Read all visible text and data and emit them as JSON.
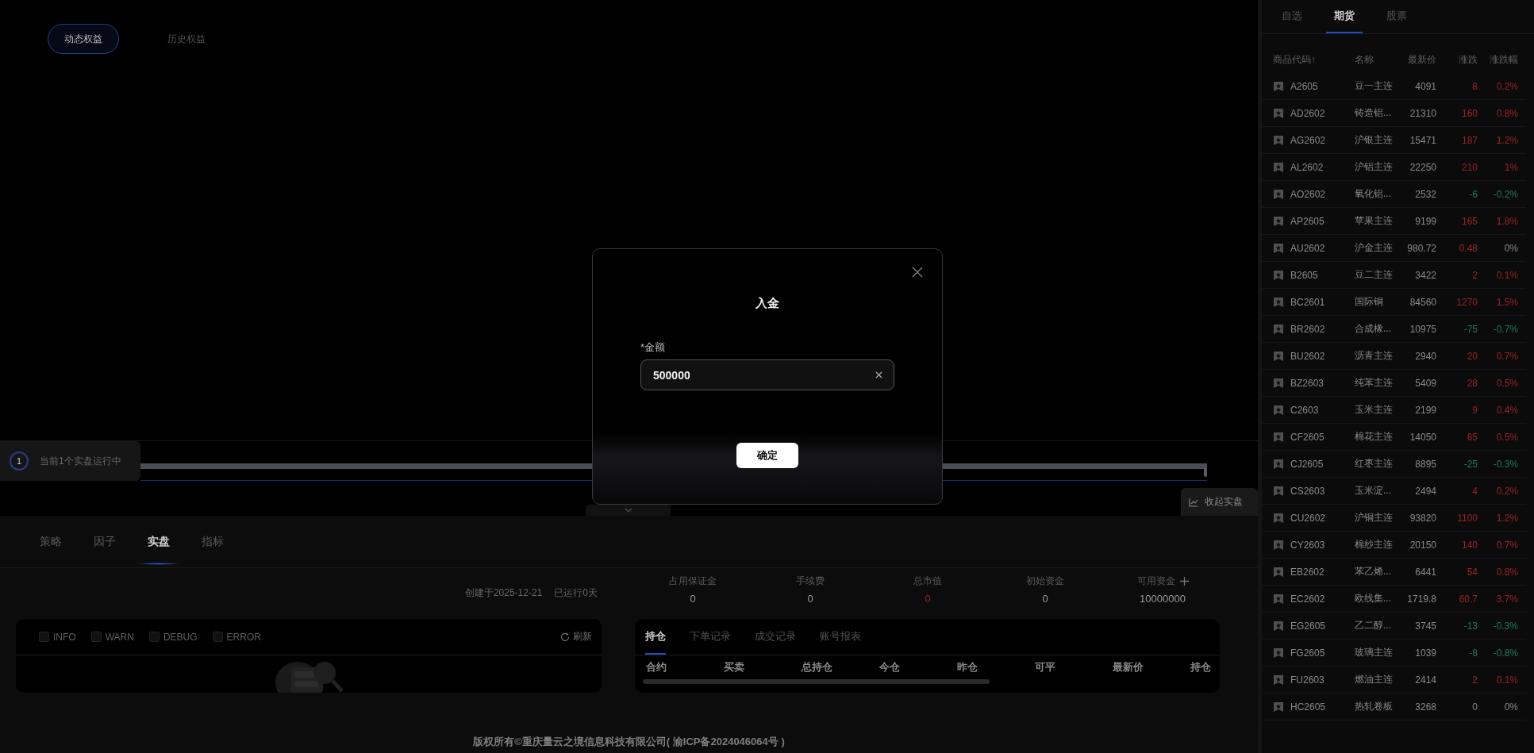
{
  "equity_tabs": [
    {
      "label": "动态权益",
      "selected": true
    },
    {
      "label": "历史权益",
      "selected": false
    }
  ],
  "running_badge": {
    "count": "1",
    "label": "当前1个实盘运行中"
  },
  "range_slider": {
    "level": 1
  },
  "collapse_button": "收起实盘",
  "bottom_tabs": [
    {
      "label": "策略",
      "selected": false
    },
    {
      "label": "因子",
      "selected": false
    },
    {
      "label": "实盘",
      "selected": true
    },
    {
      "label": "指标",
      "selected": false
    }
  ],
  "info": {
    "created": "创建于2025-12-21",
    "running": "已运行0天"
  },
  "stats": [
    {
      "label": "占用保证金",
      "value": "0",
      "color": "#9a9a9a",
      "add_button": false
    },
    {
      "label": "手续费",
      "value": "0",
      "color": "#9a9a9a",
      "add_button": false
    },
    {
      "label": "总市值",
      "value": "0",
      "color": "#9c2228",
      "add_button": false
    },
    {
      "label": "初始资金",
      "value": "0",
      "color": "#9a9a9a",
      "add_button": false
    },
    {
      "label": "可用资金",
      "value": "10000000",
      "color": "#9a9a9a",
      "add_button": true
    }
  ],
  "log_panel": {
    "levels": [
      {
        "label": "INFO",
        "checked": false
      },
      {
        "label": "WARN",
        "checked": false
      },
      {
        "label": "DEBUG",
        "checked": false
      },
      {
        "label": "ERROR",
        "checked": false
      }
    ],
    "refresh": "刷新"
  },
  "positions_panel": {
    "tabs": [
      {
        "label": "持仓",
        "selected": true
      },
      {
        "label": "下单记录",
        "selected": false
      },
      {
        "label": "成交记录",
        "selected": false
      },
      {
        "label": "账号报表",
        "selected": false
      }
    ],
    "columns": [
      "合约",
      "买卖",
      "总持仓",
      "今仓",
      "昨仓",
      "可平",
      "最新价",
      "持仓"
    ]
  },
  "footer": "版权所有©重庆量云之境信息科技有限公司( 渝ICP备2024046064号 )",
  "market": {
    "tabs": [
      {
        "label": "自选",
        "selected": false
      },
      {
        "label": "期货",
        "selected": true
      },
      {
        "label": "股票",
        "selected": false
      }
    ],
    "columns": [
      "商品代码↑",
      "名称",
      "最新价",
      "涨跌",
      "涨跌幅"
    ],
    "rows": [
      {
        "code": "A2605",
        "name": "豆一主连",
        "price": "4091",
        "change": {
          "text": "8",
          "color": "#9c2228"
        },
        "pct": {
          "text": "0.2%",
          "color": "#9c2228"
        }
      },
      {
        "code": "AD2602",
        "name": "铸造铝...",
        "price": "21310",
        "change": {
          "text": "160",
          "color": "#9c2228"
        },
        "pct": {
          "text": "0.8%",
          "color": "#9c2228"
        }
      },
      {
        "code": "AG2602",
        "name": "沪银主连",
        "price": "15471",
        "change": {
          "text": "187",
          "color": "#9c2228"
        },
        "pct": {
          "text": "1.2%",
          "color": "#9c2228"
        }
      },
      {
        "code": "AL2602",
        "name": "沪铝主连",
        "price": "22250",
        "change": {
          "text": "210",
          "color": "#9c2228"
        },
        "pct": {
          "text": "1%",
          "color": "#9c2228"
        }
      },
      {
        "code": "AO2602",
        "name": "氧化铝...",
        "price": "2532",
        "change": {
          "text": "-6",
          "color": "#1e7a58"
        },
        "pct": {
          "text": "-0.2%",
          "color": "#1e7a58"
        }
      },
      {
        "code": "AP2605",
        "name": "苹果主连",
        "price": "9199",
        "change": {
          "text": "165",
          "color": "#9c2228"
        },
        "pct": {
          "text": "1.8%",
          "color": "#9c2228"
        }
      },
      {
        "code": "AU2602",
        "name": "沪金主连",
        "price": "980.72",
        "change": {
          "text": "0.48",
          "color": "#9c2228"
        },
        "pct": {
          "text": "0%",
          "color": "#8a8a8a"
        }
      },
      {
        "code": "B2605",
        "name": "豆二主连",
        "price": "3422",
        "change": {
          "text": "2",
          "color": "#9c2228"
        },
        "pct": {
          "text": "0.1%",
          "color": "#9c2228"
        }
      },
      {
        "code": "BC2601",
        "name": "国际铜",
        "price": "84560",
        "change": {
          "text": "1270",
          "color": "#9c2228"
        },
        "pct": {
          "text": "1.5%",
          "color": "#9c2228"
        }
      },
      {
        "code": "BR2602",
        "name": "合成橡...",
        "price": "10975",
        "change": {
          "text": "-75",
          "color": "#1e7a58"
        },
        "pct": {
          "text": "-0.7%",
          "color": "#1e7a58"
        }
      },
      {
        "code": "BU2602",
        "name": "沥青主连",
        "price": "2940",
        "change": {
          "text": "20",
          "color": "#9c2228"
        },
        "pct": {
          "text": "0.7%",
          "color": "#9c2228"
        }
      },
      {
        "code": "BZ2603",
        "name": "纯苯主连",
        "price": "5409",
        "change": {
          "text": "28",
          "color": "#9c2228"
        },
        "pct": {
          "text": "0.5%",
          "color": "#9c2228"
        }
      },
      {
        "code": "C2603",
        "name": "玉米主连",
        "price": "2199",
        "change": {
          "text": "9",
          "color": "#9c2228"
        },
        "pct": {
          "text": "0.4%",
          "color": "#9c2228"
        }
      },
      {
        "code": "CF2605",
        "name": "棉花主连",
        "price": "14050",
        "change": {
          "text": "65",
          "color": "#9c2228"
        },
        "pct": {
          "text": "0.5%",
          "color": "#9c2228"
        }
      },
      {
        "code": "CJ2605",
        "name": "红枣主连",
        "price": "8895",
        "change": {
          "text": "-25",
          "color": "#1e7a58"
        },
        "pct": {
          "text": "-0.3%",
          "color": "#1e7a58"
        }
      },
      {
        "code": "CS2603",
        "name": "玉米淀...",
        "price": "2494",
        "change": {
          "text": "4",
          "color": "#9c2228"
        },
        "pct": {
          "text": "0.2%",
          "color": "#9c2228"
        }
      },
      {
        "code": "CU2602",
        "name": "沪铜主连",
        "price": "93820",
        "change": {
          "text": "1100",
          "color": "#9c2228"
        },
        "pct": {
          "text": "1.2%",
          "color": "#9c2228"
        }
      },
      {
        "code": "CY2603",
        "name": "棉纱主连",
        "price": "20150",
        "change": {
          "text": "140",
          "color": "#9c2228"
        },
        "pct": {
          "text": "0.7%",
          "color": "#9c2228"
        }
      },
      {
        "code": "EB2602",
        "name": "苯乙烯...",
        "price": "6441",
        "change": {
          "text": "54",
          "color": "#9c2228"
        },
        "pct": {
          "text": "0.8%",
          "color": "#9c2228"
        }
      },
      {
        "code": "EC2602",
        "name": "欧线集...",
        "price": "1719.8",
        "change": {
          "text": "60.7",
          "color": "#9c2228"
        },
        "pct": {
          "text": "3.7%",
          "color": "#9c2228"
        }
      },
      {
        "code": "EG2605",
        "name": "乙二醇...",
        "price": "3745",
        "change": {
          "text": "-13",
          "color": "#1e7a58"
        },
        "pct": {
          "text": "-0.3%",
          "color": "#1e7a58"
        }
      },
      {
        "code": "FG2605",
        "name": "玻璃主连",
        "price": "1039",
        "change": {
          "text": "-8",
          "color": "#1e7a58"
        },
        "pct": {
          "text": "-0.8%",
          "color": "#1e7a58"
        }
      },
      {
        "code": "FU2603",
        "name": "燃油主连",
        "price": "2414",
        "change": {
          "text": "2",
          "color": "#9c2228"
        },
        "pct": {
          "text": "0.1%",
          "color": "#9c2228"
        }
      },
      {
        "code": "HC2605",
        "name": "热轧卷板",
        "price": "3268",
        "change": {
          "text": "0",
          "color": "#8a8a8a"
        },
        "pct": {
          "text": "0%",
          "color": "#8a8a8a"
        }
      }
    ]
  },
  "dialog": {
    "title": "入金",
    "field_label": "*金额",
    "value": "500000",
    "confirm": "确定"
  }
}
